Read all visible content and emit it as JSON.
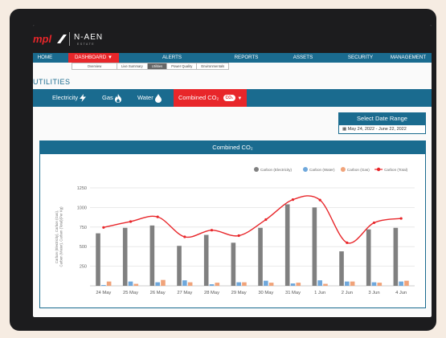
{
  "brand": {
    "logo_text": "mpl",
    "partner_logo": "N-AEN",
    "partner_sub": "ESTATE"
  },
  "nav": {
    "items": [
      {
        "label": "HOME"
      },
      {
        "label": "DASHBOARD ▼",
        "active": true
      },
      {
        "label": "ALERTS"
      },
      {
        "label": "REPORTS"
      },
      {
        "label": "ASSETS"
      },
      {
        "label": "SECURITY"
      },
      {
        "label": "MANAGEMENT"
      }
    ],
    "sub_items": [
      {
        "label": "Overview"
      },
      {
        "label": "Live Summary"
      },
      {
        "label": "Utilities",
        "active": true
      },
      {
        "label": "Power Quality"
      },
      {
        "label": "Environmentals"
      }
    ]
  },
  "section_title": "UTILITIES",
  "tabs": {
    "electricity": {
      "label": "Electricity",
      "icon": "lightning-icon"
    },
    "gas": {
      "label": "Gas",
      "icon": "flame-icon"
    },
    "water": {
      "label": "Water",
      "icon": "water-drop-icon"
    },
    "co2": {
      "label": "Combined CO₂",
      "badge": "CO₂",
      "caret": "▼",
      "active": true
    }
  },
  "date_range": {
    "button_label": "Select Date Range",
    "value": "▦ May 24, 2022 - June 22, 2022"
  },
  "panel_title": "Combined CO₂",
  "colors": {
    "brand_blue": "#1a6b8f",
    "accent_red": "#e8262a",
    "electricity": "#808080",
    "water": "#6fa8dc",
    "gas": "#f0a37a",
    "total": "#e8262a"
  },
  "chart_data": {
    "type": "bar",
    "title": "",
    "ylabel": "Carbon (Electricity), Carbon (Gas), Carbon (Water), Carbon (Total)(Per Kg)",
    "xlabel": "",
    "ylim": [
      0,
      1250
    ],
    "yticks": [
      250,
      500,
      750,
      1000,
      1250
    ],
    "grid": true,
    "legend_position": "top-right",
    "categories": [
      "24 May",
      "25 May",
      "26 May",
      "27 May",
      "28 May",
      "29 May",
      "30 May",
      "31 May",
      "1 Jun",
      "2 Jun",
      "3 Jun",
      "4 Jun"
    ],
    "series": [
      {
        "name": "Carbon (Electricity)",
        "kind": "bar",
        "color": "#808080",
        "values": [
          670,
          740,
          770,
          510,
          650,
          550,
          740,
          1040,
          1000,
          440,
          720,
          740
        ]
      },
      {
        "name": "Carbon (Water)",
        "kind": "bar",
        "color": "#6fa8dc",
        "values": [
          10,
          55,
          45,
          70,
          20,
          45,
          65,
          30,
          70,
          55,
          45,
          55
        ]
      },
      {
        "name": "Carbon (Gas)",
        "kind": "bar",
        "color": "#f0a37a",
        "values": [
          55,
          25,
          75,
          45,
          40,
          45,
          40,
          40,
          25,
          55,
          40,
          65
        ]
      },
      {
        "name": "Carbon (Total)",
        "kind": "line",
        "color": "#e8262a",
        "values": [
          745,
          820,
          880,
          625,
          710,
          640,
          845,
          1100,
          1095,
          550,
          805,
          860
        ]
      }
    ]
  }
}
